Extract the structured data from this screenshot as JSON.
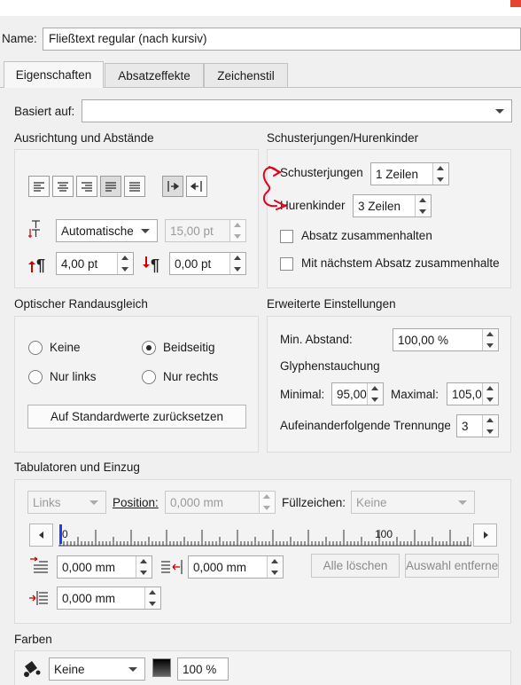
{
  "name_label": "Name:",
  "name_value": "Fließtext regular (nach kursiv)",
  "tabs": [
    "Eigenschaften",
    "Absatzeffekte",
    "Zeichenstil"
  ],
  "based_on": {
    "label": "Basiert auf:",
    "value": ""
  },
  "alignment": {
    "title": "Ausrichtung und Abstände",
    "line_spacing_mode": "Automatische",
    "line_spacing_value": "15,00 pt",
    "space_before": "4,00 pt",
    "space_after": "0,00 pt"
  },
  "widow": {
    "title": "Schusterjungen/Hurenkinder",
    "orphans_label": "Schusterjungen",
    "orphans_value": "1 Zeilen",
    "widows_label": "Hurenkinder",
    "widows_value": "3 Zeilen",
    "keep_together": "Absatz zusammenhalten",
    "keep_with_next": "Mit nächstem Absatz zusammenhalte",
    "annotation_color": "#e8001a"
  },
  "optical": {
    "title": "Optischer Randausgleich",
    "none": "Keine",
    "both": "Beidseitig",
    "left": "Nur links",
    "right": "Nur rechts",
    "reset": "Auf Standardwerte zurücksetzen"
  },
  "advanced": {
    "title": "Erweiterte Einstellungen",
    "min_spacing_label": "Min. Abstand:",
    "min_spacing_value": "100,00 %",
    "glyph_title": "Glyphenstauchung",
    "minimal_label": "Minimal:",
    "minimal_value": "95,00",
    "maximal_label": "Maximal:",
    "maximal_value": "105,0",
    "hyphen_label": "Aufeinanderfolgende Trennunge",
    "hyphen_value": "3"
  },
  "tabs_indent": {
    "title": "Tabulatoren und Einzug",
    "align": "Links",
    "position_label": "Position:",
    "position_value": "0,000 mm",
    "fill_label": "Füllzeichen:",
    "fill_value": "Keine",
    "ruler_start": "0",
    "ruler_mid": "100",
    "indent_first": "0,000 mm",
    "indent_right": "0,000 mm",
    "indent_left": "0,000 mm",
    "delete_all": "Alle löschen",
    "delete_selection": "Auswahl entferner"
  },
  "colors": {
    "title": "Farben",
    "fill_value": "Keine",
    "shade_value": "100 %"
  }
}
